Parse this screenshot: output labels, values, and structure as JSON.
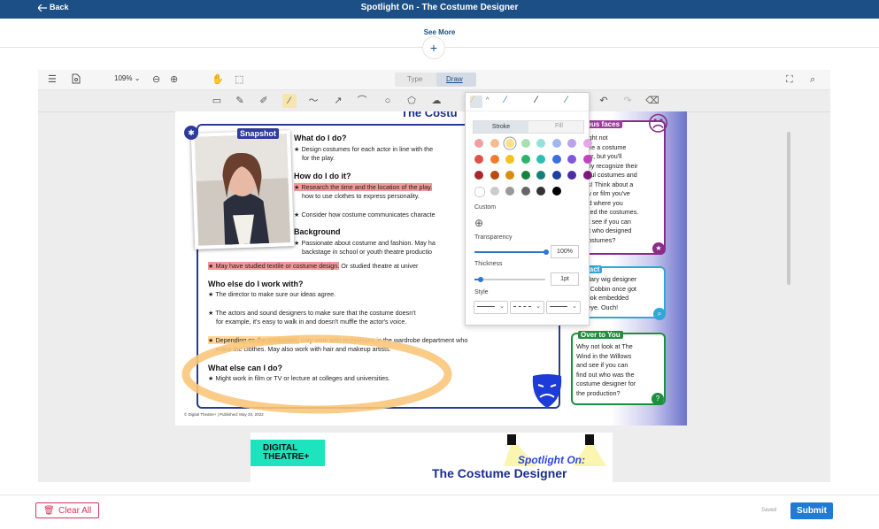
{
  "header": {
    "back_label": "Back",
    "title": "Spotlight On - The Costume Designer"
  },
  "see_more_label": "See More",
  "toolbar": {
    "zoom": "109%",
    "mode_type": "Type",
    "mode_draw": "Draw"
  },
  "document": {
    "title_partial": "The Costu",
    "snapshot_label": "Snapshot",
    "sections": [
      {
        "heading": "What do I do?",
        "bullets": [
          "Design costumes for each actor in line with the",
          "for the play."
        ]
      },
      {
        "heading": "How do I do it?",
        "bullets": [
          "Research the time and the location of the play.",
          "how to use clothes to express personality.",
          "Consider how costume communicates characte"
        ]
      },
      {
        "heading": "Background",
        "bullets": [
          "Passionate about costume and fashion. May ha",
          "backstage in school or youth theatre productio",
          "May have studied textile or costume design.",
          " Or studied theatre at univer"
        ]
      },
      {
        "heading": "Who else do I work with?",
        "bullets": [
          "The director to make sure our ideas agree.",
          "The actors and sound designers to make sure that the costume doesn't",
          "for example, it's easy to walk in and doesn't muffle the actor's voice.",
          "Depending on the production,",
          " may work with technicians in the wardrobe department who",
          "make the clothes. May also work with hair and makeup artists."
        ]
      },
      {
        "heading": "What else can I do?",
        "bullets": [
          "Might work in film or TV or lecture at colleges and universities."
        ]
      }
    ],
    "copyright": "© Digital Theatre+ | Published: May 20, 2022",
    "sidebar": {
      "famous_title": "mous faces",
      "famous_lines": [
        "u might not",
        "ognize a costume",
        "signer, but you'll",
        "finitely recognize their",
        "nderful costumes and",
        "signs! Think about a",
        "show or film you've",
        "tched where you",
        "lly liked the costumes.",
        "y not see if you can",
        "d out who designed",
        "se costumes?"
      ],
      "fun_title": "n fact",
      "fun_lines": [
        "gendary wig designer",
        "gela Cobbin once got",
        "ig hook embedded",
        "her eye. Ouch!"
      ],
      "over_title": "Over to You",
      "over_lines": [
        "Why not look at The",
        "Wind in the Willows",
        "and see if you can",
        "find out who was the",
        "costume designer for",
        "the production?"
      ]
    },
    "page2": {
      "logo_line1": "DIGITAL",
      "logo_line2": "THEATRE+",
      "spotlight": "Spotlight On:",
      "subtitle": "The Costume Designer"
    }
  },
  "draw_popup": {
    "tab_stroke": "Stroke",
    "tab_fill": "Fill",
    "colors": [
      [
        "#f0a0a0",
        "#f6bb8e",
        "#fbe08a",
        "#a6e0b0",
        "#92e3dc",
        "#9fb6f0",
        "#b9a3ef",
        "#e7a6e6"
      ],
      [
        "#e2504a",
        "#f07c2b",
        "#f3c21d",
        "#2bb56a",
        "#2bbfb1",
        "#3c6ee0",
        "#7f57df",
        "#c243c0"
      ],
      [
        "#a7282b",
        "#b64b12",
        "#d68f0a",
        "#17833f",
        "#138078",
        "#1f3ea3",
        "#4b2ea5",
        "#7b1b77"
      ],
      [
        "#ffffff",
        "#cccccc",
        "#999999",
        "#666666",
        "#333333",
        "#000000"
      ]
    ],
    "selected_color": "#fbe08a",
    "custom_label": "Custom",
    "transparency_label": "Transparency",
    "transparency_value": "100%",
    "thickness_label": "Thickness",
    "thickness_value": "1pt",
    "style_label": "Style"
  },
  "footer": {
    "clear_all_label": "Clear All",
    "saved_label": "Saved",
    "submit_label": "Submit"
  }
}
